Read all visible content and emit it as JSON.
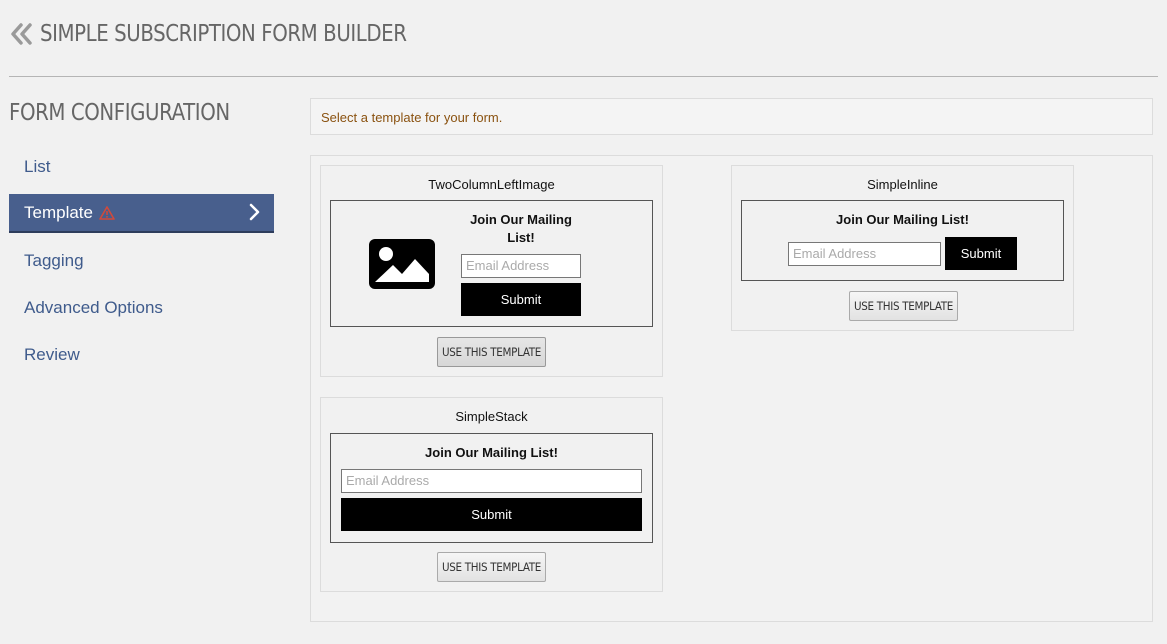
{
  "header": {
    "title": "SIMPLE SUBSCRIPTION FORM BUILDER",
    "back_icon": "double-chevron-left-icon"
  },
  "sidebar": {
    "heading": "FORM CONFIGURATION",
    "items": [
      {
        "label": "List"
      },
      {
        "label": "Template",
        "active": true,
        "warning_icon": "warning-triangle-icon",
        "chevron_icon": "chevron-right-icon"
      },
      {
        "label": "Tagging"
      },
      {
        "label": "Advanced Options"
      },
      {
        "label": "Review"
      }
    ]
  },
  "notice": "Select a template for your form.",
  "templates": [
    {
      "name": "TwoColumnLeftImage",
      "heading": "Join Our Mailing List!",
      "heading_line1": "Join Our Mailing",
      "heading_line2": "List!",
      "email_placeholder": "Email Address",
      "submit_label": "Submit",
      "image_icon": "image-placeholder-icon",
      "use_button": "USE THIS TEMPLATE"
    },
    {
      "name": "SimpleInline",
      "heading": "Join Our Mailing List!",
      "email_placeholder": "Email Address",
      "submit_label": "Submit",
      "use_button": "USE THIS TEMPLATE"
    },
    {
      "name": "SimpleStack",
      "heading": "Join Our Mailing List!",
      "email_placeholder": "Email Address",
      "submit_label": "Submit",
      "use_button": "USE THIS TEMPLATE"
    }
  ],
  "colors": {
    "accent": "#485f8d",
    "link": "#3f5b8c",
    "notice_text": "#8a5210",
    "warning": "#c0392b"
  }
}
